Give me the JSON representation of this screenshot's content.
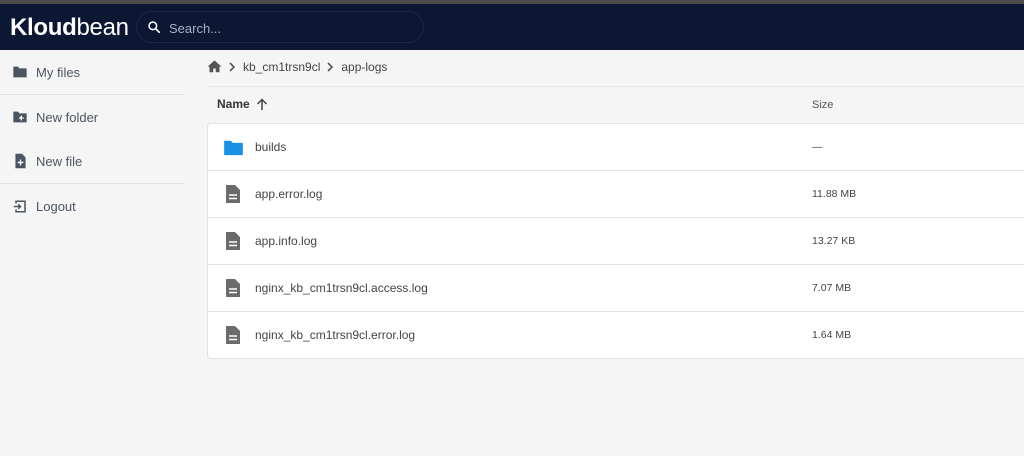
{
  "app": {
    "logo_text_bold": "Kloud",
    "logo_text_light": "bean"
  },
  "search": {
    "placeholder": "Search..."
  },
  "sidebar": {
    "items": [
      {
        "label": "My files",
        "icon": "folder-icon"
      },
      {
        "label": "New folder",
        "icon": "new-folder-icon"
      },
      {
        "label": "New file",
        "icon": "new-file-icon"
      },
      {
        "label": "Logout",
        "icon": "logout-icon"
      }
    ]
  },
  "breadcrumb": {
    "home_icon": "home-icon",
    "items": [
      "kb_cm1trsn9cl",
      "app-logs"
    ]
  },
  "list": {
    "columns": {
      "name": "Name",
      "size": "Size",
      "sort_icon": "arrow-up-icon"
    },
    "rows": [
      {
        "name": "builds",
        "size": "—",
        "type": "folder"
      },
      {
        "name": "app.error.log",
        "size": "11.88 MB",
        "type": "file"
      },
      {
        "name": "app.info.log",
        "size": "13.27 KB",
        "type": "file"
      },
      {
        "name": "nginx_kb_cm1trsn9cl.access.log",
        "size": "7.07 MB",
        "type": "file"
      },
      {
        "name": "nginx_kb_cm1trsn9cl.error.log",
        "size": "1.64 MB",
        "type": "file"
      }
    ]
  },
  "colors": {
    "header_bg": "#0b1733",
    "folder": "#1a8fe6",
    "file_icon": "#6b6b6b",
    "sidebar_icon": "#4a5563"
  }
}
